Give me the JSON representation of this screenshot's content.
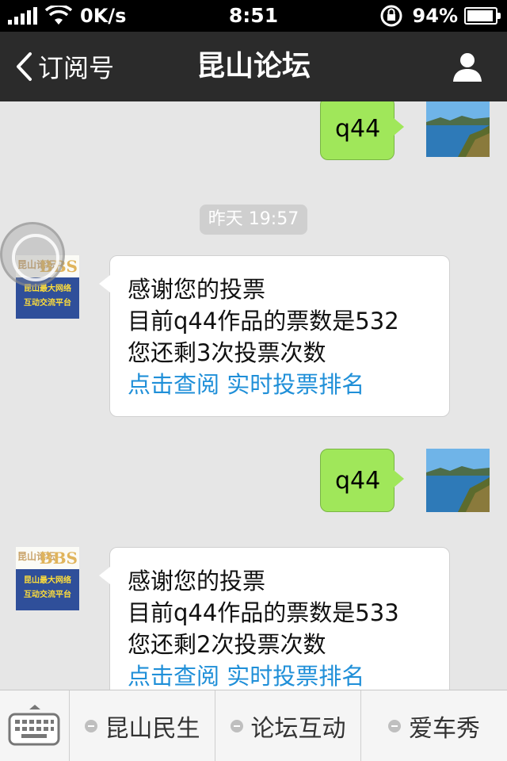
{
  "status_bar": {
    "network_speed": "0K/s",
    "time": "8:51",
    "battery_percent": "94%",
    "battery_level": 0.94
  },
  "nav": {
    "back_label": "订阅号",
    "title": "昆山论坛",
    "icons": {
      "back": "chevron-left-icon",
      "profile": "person-icon"
    }
  },
  "chat": {
    "messages": [
      {
        "from": "me",
        "text": "q44"
      },
      {
        "type": "timestamp",
        "text": "昨天 19:57"
      },
      {
        "from": "account",
        "lines": [
          "感谢您的投票",
          "目前q44作品的票数是532",
          "您还剩3次投票次数"
        ],
        "links": [
          "点击查阅",
          "实时投票排名"
        ]
      },
      {
        "from": "me",
        "text": "q44"
      },
      {
        "from": "account",
        "lines": [
          "感谢您的投票",
          "目前q44作品的票数是533",
          "您还剩2次投票次数"
        ],
        "links": [
          "点击查阅",
          "实时投票排名"
        ]
      }
    ],
    "account_logo": {
      "bbs_text": "BBS",
      "logo_small_text": "昆山论坛",
      "slogan_line1": "昆山最大网络",
      "slogan_line2": "互动交流平台"
    }
  },
  "menu": {
    "items": [
      "昆山民生",
      "论坛互动",
      "爱车秀"
    ],
    "keyboard_icon": "keyboard-icon"
  },
  "colors": {
    "green_bubble": "#a0e75a",
    "link": "#1f8fd8",
    "nav_bg": "#2b2b2b"
  }
}
